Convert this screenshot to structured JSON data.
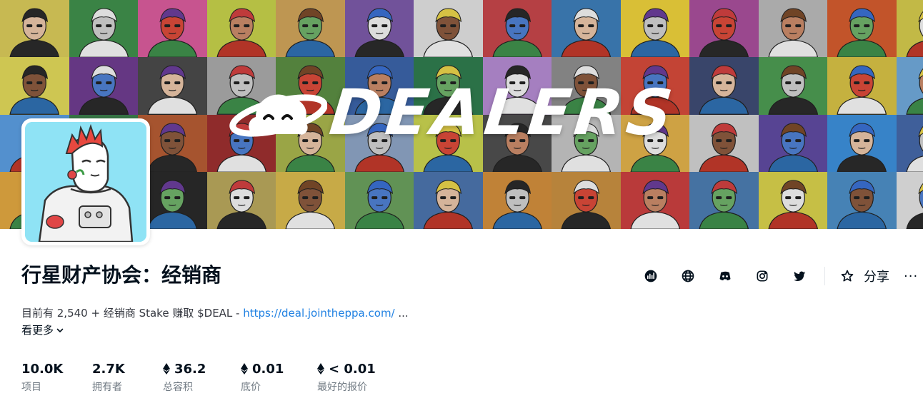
{
  "banner": {
    "logo_text": "DEALERS",
    "tile_colors": [
      "#d8c95a",
      "#3f8f4b",
      "#d85c9c",
      "#c5d04a",
      "#cfa35a",
      "#7b5aa8",
      "#e0e0e0",
      "#c5464a",
      "#3d7db8",
      "#ecd03b",
      "#a84f9b",
      "#b9b9b9",
      "#d35c2e",
      "#d3c94d",
      "#e0d75a",
      "#6e3c8f",
      "#4a4a4a",
      "#a9a9a9",
      "#5b8c43",
      "#3b63a8",
      "#2f7b4e",
      "#b48ad1",
      "#8e8e8e",
      "#d44a3a",
      "#3e4b74",
      "#4d9b52",
      "#d6c045",
      "#6fa8d8",
      "#5b9de0",
      "#3b7e4b",
      "#b55c34",
      "#9c2f2f",
      "#a8b44d",
      "#8ca3c4",
      "#c8d250",
      "#4f4f4f",
      "#c4c4c4",
      "#e0b04a",
      "#d1d1d1",
      "#5f4aa0",
      "#3c8fd9",
      "#4568a8",
      "#e0a640",
      "#5a8fb3",
      "#2a2a2a",
      "#b8a65c",
      "#d8b94e",
      "#6a9f5d",
      "#4b73ac",
      "#d18e3c",
      "#c78f40",
      "#c93f3f",
      "#4b7cb0",
      "#d7d04b",
      "#4d8ec5",
      "#e1e1e1"
    ]
  },
  "collection": {
    "title": "行星财产协会：经销商",
    "description_prefix": "目前有 2,540 + 经销商 Stake 赚取 $DEAL - ",
    "description_link": "https://deal.jointheppa.com/",
    "description_suffix": " ...",
    "see_more": "看更多"
  },
  "social": {
    "icons": [
      "activity-chart-icon",
      "website-globe-icon",
      "discord-icon",
      "instagram-icon",
      "twitter-icon"
    ],
    "favorite_icon": "star-icon",
    "share_label": "分享",
    "more_label": "···"
  },
  "stats": [
    {
      "value": "10.0K",
      "label": "项目",
      "eth": false
    },
    {
      "value": "2.7K",
      "label": "拥有者",
      "eth": false
    },
    {
      "value": "36.2",
      "label": "总容积",
      "eth": true
    },
    {
      "value": "0.01",
      "label": "底价",
      "eth": true
    },
    {
      "value": "< 0.01",
      "label": "最好的报价",
      "eth": true
    }
  ],
  "colors": {
    "link": "#2081e2",
    "text_primary": "#04111d",
    "text_secondary": "#707a83",
    "avatar_bg": "#8fe3f5"
  }
}
